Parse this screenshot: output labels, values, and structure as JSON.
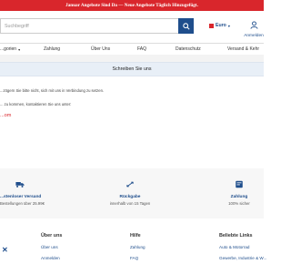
{
  "promo": {
    "text": "Januar Angebote Sind Da — Neue Angebote Täglich Hinzugefügt."
  },
  "header": {
    "search_placeholder": "Suchbegriff",
    "currency": "Euro",
    "account_label": "Anmelden"
  },
  "nav": {
    "items": [
      "...gorien",
      "Zahlung",
      "Über Uns",
      "FAQ",
      "Datenschutz",
      "Versand & Kehr"
    ]
  },
  "page": {
    "title": "Schreiben Sie uns",
    "lines": [
      "...zögern Sie bitte nicht, sich mit uns in Verbindung zu setzen.",
      "... zu kommen, kontaktieren Sie uns unter:"
    ],
    "email": "...om"
  },
  "features": [
    {
      "icon": "truck-icon",
      "title": "...stenloser Versand",
      "subtitle": "Bestellungen über 25.99€"
    },
    {
      "icon": "return-arrows-icon",
      "title": "Rückgabe",
      "subtitle": "innerhalb von 15 Tagen"
    },
    {
      "icon": "payment-card-icon",
      "title": "Zahlung",
      "subtitle": "100% sicher"
    }
  ],
  "footer": {
    "columns": [
      {
        "heading": "Über uns",
        "links": [
          "Über uns",
          "Anmelden"
        ]
      },
      {
        "heading": "Hilfe",
        "links": [
          "Zahlung",
          "FAQ"
        ]
      },
      {
        "heading": "Beliebte Links",
        "links": [
          "Auto & Motorrad",
          "Gewerbe, Industrie & W..."
        ]
      }
    ]
  },
  "colors": {
    "brand_blue": "#1f4e8c",
    "promo_red": "#d9262c"
  }
}
